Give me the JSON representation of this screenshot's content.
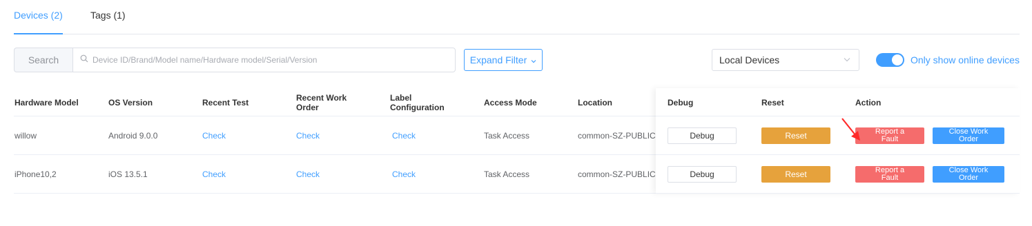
{
  "tabs": [
    {
      "label": "Devices (2)",
      "active": true
    },
    {
      "label": "Tags (1)",
      "active": false
    }
  ],
  "toolbar": {
    "search_label": "Search",
    "search_placeholder": "Device ID/Brand/Model name/Hardware model/Serial/Version",
    "expand_filter_label": "Expand Filter",
    "device_source": "Local Devices",
    "online_toggle_label": "Only show online devices",
    "online_toggle_on": true
  },
  "table": {
    "headers": {
      "hardware_model": "Hardware Model",
      "os_version": "OS Version",
      "recent_test": "Recent Test",
      "recent_work_order_1": "Recent Work",
      "recent_work_order_2": "Order",
      "label_config_1": "Label",
      "label_config_2": "Configuration",
      "access_mode": "Access Mode",
      "location": "Location",
      "debug": "Debug",
      "reset": "Reset",
      "action": "Action"
    },
    "rows": [
      {
        "hardware_model": "willow",
        "os_version": "Android 9.0.0",
        "recent_test": "Check",
        "recent_work_order": "Check",
        "label_config": "Check",
        "access_mode": "Task Access",
        "location": "common-SZ-PUBLIC",
        "debug": "Debug",
        "reset": "Reset",
        "fault_1": "Report a",
        "fault_2": "Fault",
        "order_1": "Close Work",
        "order_2": "Order"
      },
      {
        "hardware_model": "iPhone10,2",
        "os_version": "iOS 13.5.1",
        "recent_test": "Check",
        "recent_work_order": "Check",
        "label_config": "Check",
        "access_mode": "Task Access",
        "location": "common-SZ-PUBLIC",
        "debug": "Debug",
        "reset": "Reset",
        "fault_1": "Report a",
        "fault_2": "Fault",
        "order_1": "Close Work",
        "order_2": "Order"
      }
    ]
  },
  "colors": {
    "primary": "#409eff",
    "warning": "#e6a23c",
    "danger": "#f56c6c",
    "annotation_arrow": "#ff2a2a"
  }
}
